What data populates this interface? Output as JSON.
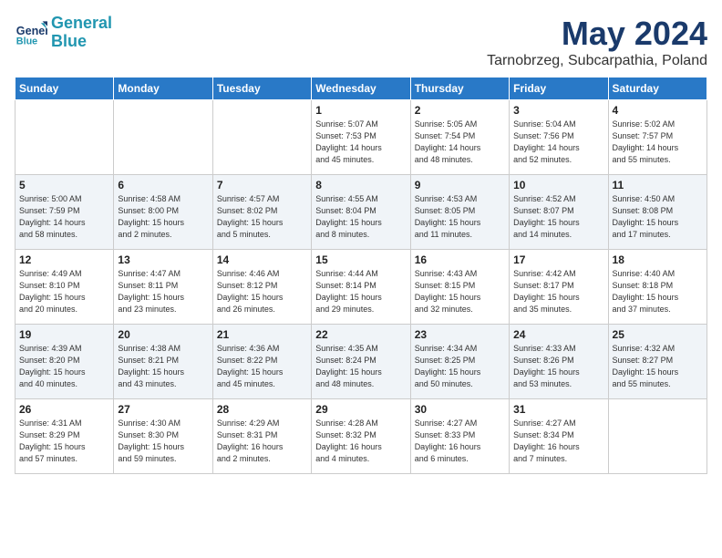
{
  "header": {
    "logo_line1": "General",
    "logo_line2": "Blue",
    "month": "May 2024",
    "location": "Tarnobrzeg, Subcarpathia, Poland"
  },
  "weekdays": [
    "Sunday",
    "Monday",
    "Tuesday",
    "Wednesday",
    "Thursday",
    "Friday",
    "Saturday"
  ],
  "weeks": [
    [
      {
        "day": "",
        "info": ""
      },
      {
        "day": "",
        "info": ""
      },
      {
        "day": "",
        "info": ""
      },
      {
        "day": "1",
        "info": "Sunrise: 5:07 AM\nSunset: 7:53 PM\nDaylight: 14 hours\nand 45 minutes."
      },
      {
        "day": "2",
        "info": "Sunrise: 5:05 AM\nSunset: 7:54 PM\nDaylight: 14 hours\nand 48 minutes."
      },
      {
        "day": "3",
        "info": "Sunrise: 5:04 AM\nSunset: 7:56 PM\nDaylight: 14 hours\nand 52 minutes."
      },
      {
        "day": "4",
        "info": "Sunrise: 5:02 AM\nSunset: 7:57 PM\nDaylight: 14 hours\nand 55 minutes."
      }
    ],
    [
      {
        "day": "5",
        "info": "Sunrise: 5:00 AM\nSunset: 7:59 PM\nDaylight: 14 hours\nand 58 minutes."
      },
      {
        "day": "6",
        "info": "Sunrise: 4:58 AM\nSunset: 8:00 PM\nDaylight: 15 hours\nand 2 minutes."
      },
      {
        "day": "7",
        "info": "Sunrise: 4:57 AM\nSunset: 8:02 PM\nDaylight: 15 hours\nand 5 minutes."
      },
      {
        "day": "8",
        "info": "Sunrise: 4:55 AM\nSunset: 8:04 PM\nDaylight: 15 hours\nand 8 minutes."
      },
      {
        "day": "9",
        "info": "Sunrise: 4:53 AM\nSunset: 8:05 PM\nDaylight: 15 hours\nand 11 minutes."
      },
      {
        "day": "10",
        "info": "Sunrise: 4:52 AM\nSunset: 8:07 PM\nDaylight: 15 hours\nand 14 minutes."
      },
      {
        "day": "11",
        "info": "Sunrise: 4:50 AM\nSunset: 8:08 PM\nDaylight: 15 hours\nand 17 minutes."
      }
    ],
    [
      {
        "day": "12",
        "info": "Sunrise: 4:49 AM\nSunset: 8:10 PM\nDaylight: 15 hours\nand 20 minutes."
      },
      {
        "day": "13",
        "info": "Sunrise: 4:47 AM\nSunset: 8:11 PM\nDaylight: 15 hours\nand 23 minutes."
      },
      {
        "day": "14",
        "info": "Sunrise: 4:46 AM\nSunset: 8:12 PM\nDaylight: 15 hours\nand 26 minutes."
      },
      {
        "day": "15",
        "info": "Sunrise: 4:44 AM\nSunset: 8:14 PM\nDaylight: 15 hours\nand 29 minutes."
      },
      {
        "day": "16",
        "info": "Sunrise: 4:43 AM\nSunset: 8:15 PM\nDaylight: 15 hours\nand 32 minutes."
      },
      {
        "day": "17",
        "info": "Sunrise: 4:42 AM\nSunset: 8:17 PM\nDaylight: 15 hours\nand 35 minutes."
      },
      {
        "day": "18",
        "info": "Sunrise: 4:40 AM\nSunset: 8:18 PM\nDaylight: 15 hours\nand 37 minutes."
      }
    ],
    [
      {
        "day": "19",
        "info": "Sunrise: 4:39 AM\nSunset: 8:20 PM\nDaylight: 15 hours\nand 40 minutes."
      },
      {
        "day": "20",
        "info": "Sunrise: 4:38 AM\nSunset: 8:21 PM\nDaylight: 15 hours\nand 43 minutes."
      },
      {
        "day": "21",
        "info": "Sunrise: 4:36 AM\nSunset: 8:22 PM\nDaylight: 15 hours\nand 45 minutes."
      },
      {
        "day": "22",
        "info": "Sunrise: 4:35 AM\nSunset: 8:24 PM\nDaylight: 15 hours\nand 48 minutes."
      },
      {
        "day": "23",
        "info": "Sunrise: 4:34 AM\nSunset: 8:25 PM\nDaylight: 15 hours\nand 50 minutes."
      },
      {
        "day": "24",
        "info": "Sunrise: 4:33 AM\nSunset: 8:26 PM\nDaylight: 15 hours\nand 53 minutes."
      },
      {
        "day": "25",
        "info": "Sunrise: 4:32 AM\nSunset: 8:27 PM\nDaylight: 15 hours\nand 55 minutes."
      }
    ],
    [
      {
        "day": "26",
        "info": "Sunrise: 4:31 AM\nSunset: 8:29 PM\nDaylight: 15 hours\nand 57 minutes."
      },
      {
        "day": "27",
        "info": "Sunrise: 4:30 AM\nSunset: 8:30 PM\nDaylight: 15 hours\nand 59 minutes."
      },
      {
        "day": "28",
        "info": "Sunrise: 4:29 AM\nSunset: 8:31 PM\nDaylight: 16 hours\nand 2 minutes."
      },
      {
        "day": "29",
        "info": "Sunrise: 4:28 AM\nSunset: 8:32 PM\nDaylight: 16 hours\nand 4 minutes."
      },
      {
        "day": "30",
        "info": "Sunrise: 4:27 AM\nSunset: 8:33 PM\nDaylight: 16 hours\nand 6 minutes."
      },
      {
        "day": "31",
        "info": "Sunrise: 4:27 AM\nSunset: 8:34 PM\nDaylight: 16 hours\nand 7 minutes."
      },
      {
        "day": "",
        "info": ""
      }
    ]
  ]
}
